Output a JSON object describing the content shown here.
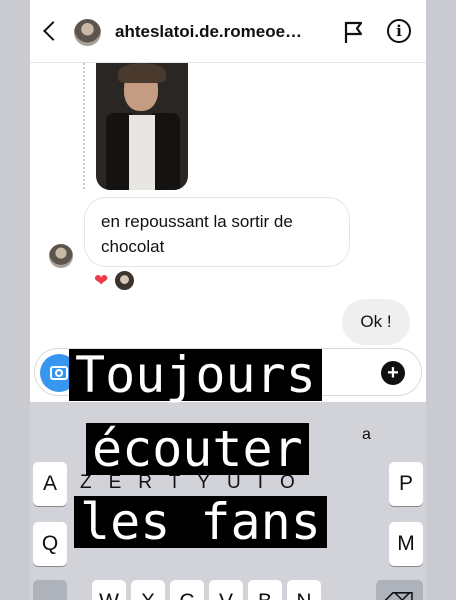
{
  "header": {
    "username": "ahteslatoi.de.romeoe…",
    "icons": [
      "back-arrow-icon",
      "avatar",
      "flag-icon",
      "info-icon"
    ]
  },
  "thread": {
    "incoming_message": "en repoussant la sortir de chocolat",
    "reaction": "❤",
    "outgoing_message": "Ok !"
  },
  "composer": {
    "icons": [
      "camera-icon",
      "plus-icon"
    ]
  },
  "keyboard": {
    "suggestion_partial": "a",
    "row1": [
      "A",
      "P"
    ],
    "row2": [
      "Q",
      "M"
    ],
    "row3": [
      "W",
      "X",
      "C",
      "V",
      "B",
      "N"
    ],
    "row1_hidden": [
      "Z",
      "E",
      "R",
      "T",
      "Y",
      "U",
      "I",
      "O"
    ]
  },
  "caption": {
    "line1": "Toujours",
    "line2": "écouter",
    "line3": "les fans"
  },
  "colors": {
    "accent_blue": "#3797f0",
    "heart_red": "#ed3b4a",
    "caption_bg": "#000000",
    "caption_text": "#ffffff"
  }
}
